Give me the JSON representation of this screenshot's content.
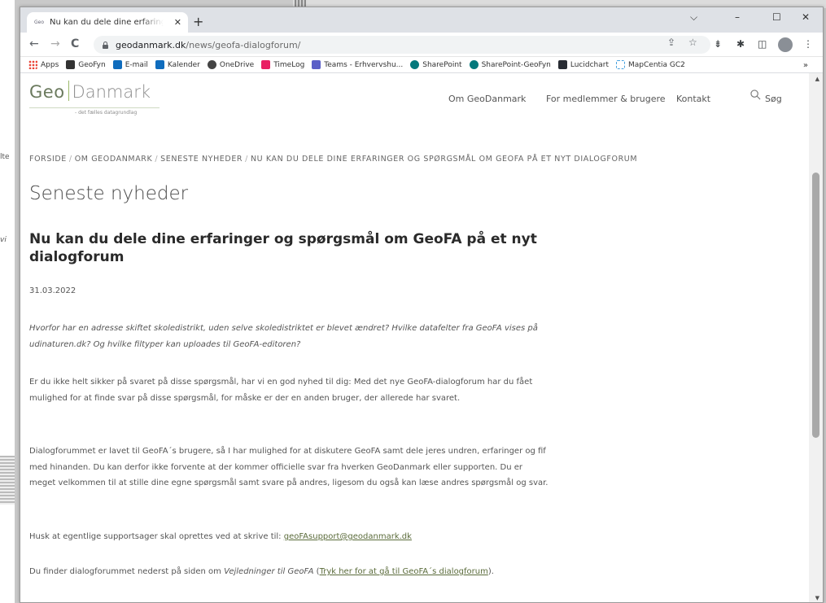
{
  "background": {
    "fragments": [
      "lte",
      "vi"
    ]
  },
  "browser": {
    "tab": {
      "favicon_text": "Geo",
      "title": "Nu kan du dele dine erfaringer og spørgsmål om GeoFA på et nyt dialogforum",
      "close": "✕"
    },
    "newtab": "+",
    "window_controls": {
      "chevron": "⌵",
      "minimize": "–",
      "maximize": "☐",
      "close": "✕"
    },
    "nav": {
      "back": "←",
      "forward": "→",
      "reload": "C"
    },
    "url": {
      "host": "geodanmark.dk",
      "path": "/news/geofa-dialogforum/"
    },
    "omnibox_icons": {
      "share": "⇪",
      "star": "☆"
    },
    "extensions": {
      "puzzle": "✱",
      "sidepanel": "◫",
      "menu": "⋮",
      "ext1": "⇟"
    },
    "bookmarks": [
      {
        "label": "Apps",
        "icon": "apps-grid",
        "color": "#f4b400"
      },
      {
        "label": "GeoFyn",
        "icon": "geofyn",
        "color": "#333333"
      },
      {
        "label": "E-mail",
        "icon": "outlook",
        "color": "#0f6cbd"
      },
      {
        "label": "Kalender",
        "icon": "calendar",
        "color": "#0f6cbd"
      },
      {
        "label": "OneDrive",
        "icon": "onedrive",
        "color": "#444444"
      },
      {
        "label": "TimeLog",
        "icon": "timelog",
        "color": "#e91e63"
      },
      {
        "label": "Teams - Erhvervshu...",
        "icon": "teams",
        "color": "#5b5fc7"
      },
      {
        "label": "SharePoint",
        "icon": "sharepoint",
        "color": "#03787c"
      },
      {
        "label": "SharePoint-GeoFyn",
        "icon": "sharepoint",
        "color": "#03787c"
      },
      {
        "label": "Lucidchart",
        "icon": "lucidchart",
        "color": "#282c33"
      },
      {
        "label": "MapCentia GC2",
        "icon": "mapcentia",
        "color": "#4aa3df"
      }
    ],
    "bookmarks_more": "»"
  },
  "site": {
    "logo": {
      "geo": "Geo",
      "danmark": "Danmark",
      "tagline": "- det fælles datagrundlag"
    },
    "nav": [
      {
        "label": "Om GeoDanmark"
      },
      {
        "label": "For medlemmer & brugere"
      },
      {
        "label": "Kontakt"
      }
    ],
    "search_label": "Søg",
    "breadcrumb": [
      "FORSIDE",
      "OM GEODANMARK",
      "SENESTE NYHEDER",
      "NU KAN DU DELE DINE ERFARINGER OG SPØRGSMÅL OM GEOFA PÅ ET NYT DIALOGFORUM"
    ],
    "breadcrumb_sep": "/",
    "page_title": "Seneste nyheder",
    "article": {
      "title": "Nu kan du dele dine erfaringer og spørgsmål om GeoFA på et nyt dialogforum",
      "date": "31.03.2022",
      "intro": "Hvorfor har en adresse skiftet skoledistrikt, uden selve skoledistriktet er blevet ændret? Hvilke datafelter fra GeoFA vises på udinaturen.dk? Og hvilke filtyper kan uploades til GeoFA-editoren?",
      "p1": "Er du ikke helt sikker på svaret på disse spørgsmål, har vi en god nyhed til dig: Med det nye GeoFA-dialogforum har du fået mulighed for at finde svar på disse spørgsmål, for måske er der en anden bruger, der allerede har svaret.",
      "p2": "Dialogforummet er lavet til GeoFA´s brugere, så I har mulighed for at diskutere GeoFA samt dele jeres undren, erfaringer og fif med hinanden. Du kan derfor ikke forvente at der kommer officielle svar fra hverken GeoDanmark eller supporten. Du er meget velkommen til at stille dine egne spørgsmål samt svare på andres, ligesom du også kan læse andres spørgsmål og svar.",
      "p3_prefix": "Husk at egentlige supportsager skal oprettes ved at skrive til: ",
      "p3_link": "geoFAsupport@geodanmark.dk",
      "p4_prefix": "Du finder dialogforummet nederst på siden om ",
      "p4_italic": "Vejledninger til GeoFA",
      "p4_open": " (",
      "p4_link": "Tryk her for at gå til GeoFA´s dialogforum",
      "p4_close": ")."
    }
  },
  "colors": {
    "accent_green": "#9bb86a",
    "link": "#5a6b3a"
  }
}
